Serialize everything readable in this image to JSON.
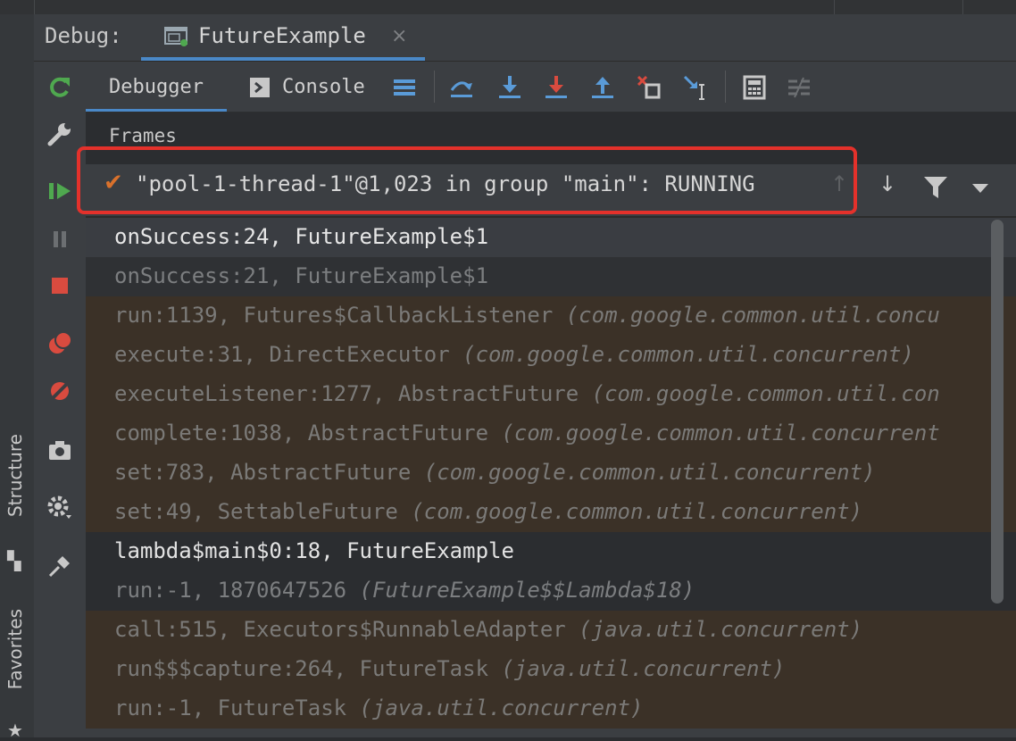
{
  "debug_header": {
    "title": "Debug:",
    "run_tab_label": "FutureExample",
    "close_glyph": "×"
  },
  "left_strip": {
    "structure_label": "Structure",
    "favorites_label": "Favorites",
    "structure_icon": "structure-icon",
    "favorites_icon": "star-icon"
  },
  "toolbar": {
    "tabs": [
      {
        "label": "Debugger",
        "active": true
      },
      {
        "label": "Console",
        "active": false
      }
    ],
    "icons": [
      "layout-menu-icon",
      "show-execution-point-icon",
      "step-over-icon",
      "step-into-icon",
      "force-step-into-icon",
      "step-out-icon",
      "drop-frame-icon",
      "run-to-cursor-icon",
      "evaluate-expression-icon",
      "trace-icon"
    ]
  },
  "actions": [
    "rerun-icon",
    "settings-wrench-icon",
    "resume-icon",
    "pause-icon",
    "stop-icon",
    "view-breakpoints-icon",
    "mute-breakpoints-icon",
    "camera-icon",
    "settings-gear-icon",
    "pin-icon"
  ],
  "frames": {
    "label": "Frames",
    "thread": {
      "check": "✔",
      "text": "\"pool-1-thread-1\"@1,023 in group \"main\": RUNNING"
    },
    "rows": [
      {
        "method": "onSuccess:24, FutureExample$1",
        "pkg": "",
        "style": "selected"
      },
      {
        "method": "onSuccess:21, FutureExample$1",
        "pkg": "",
        "style": "dim"
      },
      {
        "method": "run:1139, Futures$CallbackListener ",
        "pkg": "(com.google.common.util.concu",
        "style": "lib"
      },
      {
        "method": "execute:31, DirectExecutor ",
        "pkg": "(com.google.common.util.concurrent)",
        "style": "lib"
      },
      {
        "method": "executeListener:1277, AbstractFuture ",
        "pkg": "(com.google.common.util.con",
        "style": "lib"
      },
      {
        "method": "complete:1038, AbstractFuture ",
        "pkg": "(com.google.common.util.concurrent",
        "style": "lib"
      },
      {
        "method": "set:783, AbstractFuture ",
        "pkg": "(com.google.common.util.concurrent)",
        "style": "lib"
      },
      {
        "method": "set:49, SettableFuture ",
        "pkg": "(com.google.common.util.concurrent)",
        "style": "lib"
      },
      {
        "method": "lambda$main$0:18, FutureExample",
        "pkg": "",
        "style": "bright"
      },
      {
        "method": "run:-1, 1870647526 ",
        "pkg": "(FutureExample$$Lambda$18)",
        "style": "dim2"
      },
      {
        "method": "call:515, Executors$RunnableAdapter ",
        "pkg": "(java.util.concurrent)",
        "style": "lib"
      },
      {
        "method": "run$$$capture:264, FutureTask ",
        "pkg": "(java.util.concurrent)",
        "style": "lib"
      },
      {
        "method": "run:-1, FutureTask ",
        "pkg": "(java.util.concurrent)",
        "style": "lib"
      }
    ]
  },
  "colors": {
    "accent_blue": "#4a88c7",
    "highlight_red": "#e4312b",
    "check_orange": "#d9712c",
    "resume_green": "#4fa84f",
    "stop_red": "#d94b3f"
  }
}
